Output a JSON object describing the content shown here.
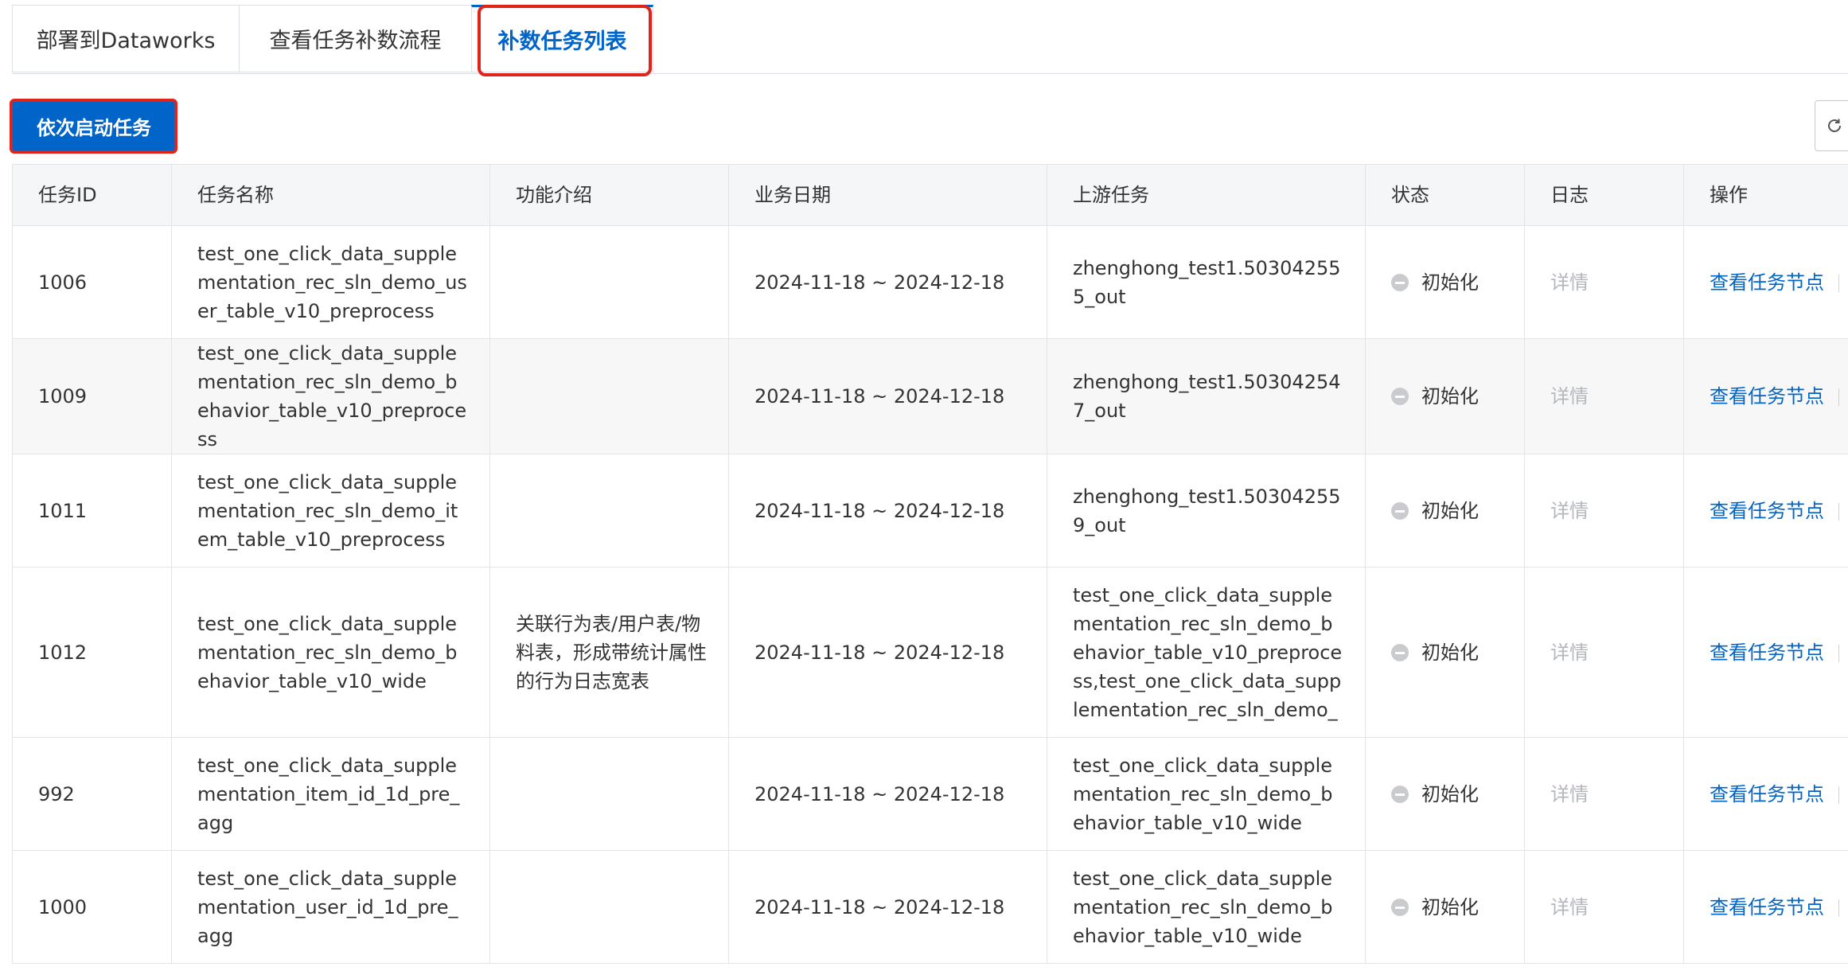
{
  "tabs": [
    {
      "label": "部署到Dataworks",
      "active": false
    },
    {
      "label": "查看任务补数流程",
      "active": false
    },
    {
      "label": "补数任务列表",
      "active": true
    }
  ],
  "toolbar": {
    "start_label": "依次启动任务",
    "refresh_icon": "refresh-icon"
  },
  "table": {
    "columns": [
      "任务ID",
      "任务名称",
      "功能介绍",
      "业务日期",
      "上游任务",
      "状态",
      "日志",
      "操作"
    ],
    "rows": [
      {
        "id": "1006",
        "name": "test_one_click_data_supplementation_rec_sln_demo_user_table_v10_preprocess",
        "desc": "",
        "date": "2024-11-18 ~ 2024-12-18",
        "upstream": "zhenghong_test1.503042555_out",
        "status": "初始化",
        "log": "详情",
        "op": "查看任务节点"
      },
      {
        "id": "1009",
        "name": "test_one_click_data_supplementation_rec_sln_demo_behavior_table_v10_preprocess",
        "desc": "",
        "date": "2024-11-18 ~ 2024-12-18",
        "upstream": "zhenghong_test1.503042547_out",
        "status": "初始化",
        "log": "详情",
        "op": "查看任务节点"
      },
      {
        "id": "1011",
        "name": "test_one_click_data_supplementation_rec_sln_demo_item_table_v10_preprocess",
        "desc": "",
        "date": "2024-11-18 ~ 2024-12-18",
        "upstream": "zhenghong_test1.503042559_out",
        "status": "初始化",
        "log": "详情",
        "op": "查看任务节点"
      },
      {
        "id": "1012",
        "name": "test_one_click_data_supplementation_rec_sln_demo_behavior_table_v10_wide",
        "desc": "关联行为表/用户表/物料表，形成带统计属性的行为日志宽表",
        "date": "2024-11-18 ~ 2024-12-18",
        "upstream": "test_one_click_data_supplementation_rec_sln_demo_behavior_table_v10_preprocess,test_one_click_data_supplementation_rec_sln_demo_",
        "status": "初始化",
        "log": "详情",
        "op": "查看任务节点"
      },
      {
        "id": "992",
        "name": "test_one_click_data_supplementation_item_id_1d_pre_agg",
        "desc": "",
        "date": "2024-11-18 ~ 2024-12-18",
        "upstream": "test_one_click_data_supplementation_rec_sln_demo_behavior_table_v10_wide",
        "status": "初始化",
        "log": "详情",
        "op": "查看任务节点"
      },
      {
        "id": "1000",
        "name": "test_one_click_data_supplementation_user_id_1d_pre_agg",
        "desc": "",
        "date": "2024-11-18 ~ 2024-12-18",
        "upstream": "test_one_click_data_supplementation_rec_sln_demo_behavior_table_v10_wide",
        "status": "初始化",
        "log": "详情",
        "op": "查看任务节点"
      }
    ]
  },
  "colors": {
    "primary": "#0064c8",
    "highlight": "#e2231a",
    "status_init": "#c9cbcf",
    "header_bg": "#f5f6f7"
  }
}
